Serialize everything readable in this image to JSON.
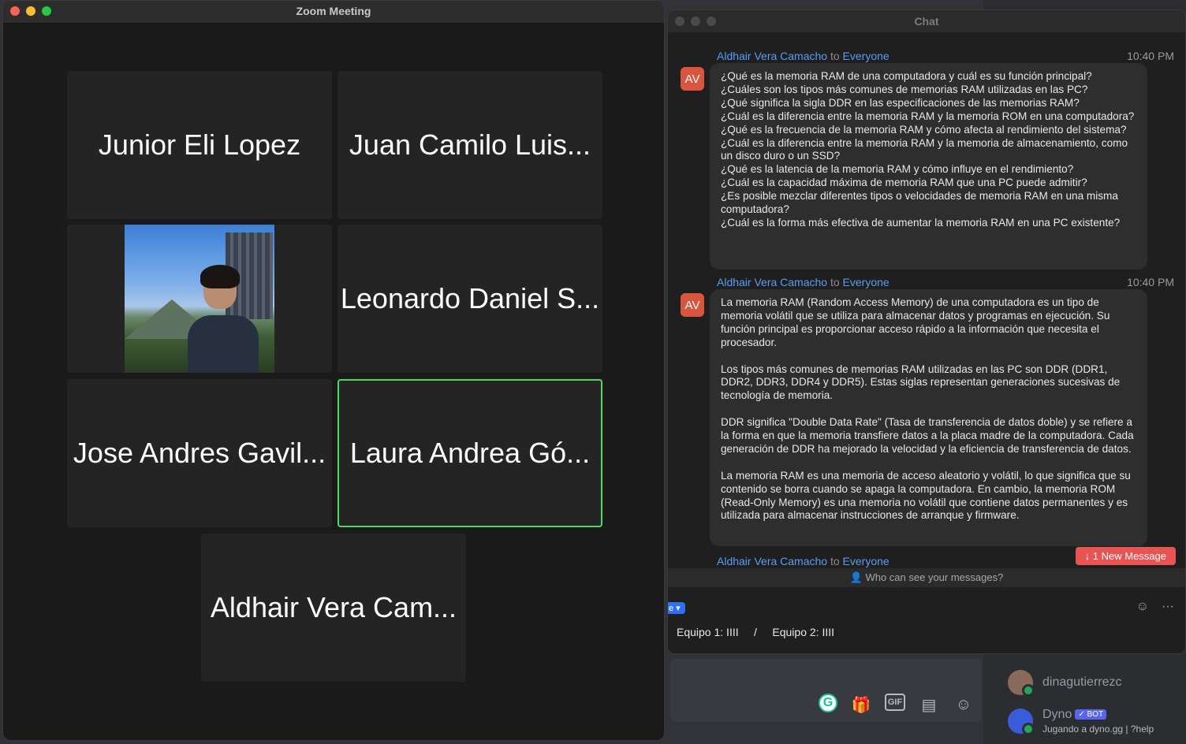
{
  "zoom": {
    "title": "Zoom Meeting",
    "participants": [
      {
        "name": "Junior Eli Lopez"
      },
      {
        "name": "Juan Camilo Luis..."
      },
      {
        "name": ""
      },
      {
        "name": "Leonardo Daniel S..."
      },
      {
        "name": "Jose Andres Gavil..."
      },
      {
        "name": "Laura Andrea Gó...",
        "active": true
      },
      {
        "name": "Aldhair Vera Cam..."
      }
    ]
  },
  "chat": {
    "title": "Chat",
    "messages": [
      {
        "sender": "Aldhair Vera Camacho",
        "to_word": "to",
        "recipient": "Everyone",
        "time": "10:40 PM",
        "avatar": "AV",
        "lines": [
          "¿Qué es la memoria RAM de una computadora y cuál es su función principal?",
          "¿Cuáles son los tipos más comunes de memorias RAM utilizadas en las PC?",
          "¿Qué significa la sigla DDR en las especificaciones de las memorias RAM?",
          "¿Cuál es la diferencia entre la memoria RAM y la memoria ROM en una computadora?",
          "¿Qué es la frecuencia de la memoria RAM y cómo afecta al rendimiento del sistema?",
          "¿Cuál es la diferencia entre la memoria RAM y la memoria de almacenamiento, como un disco duro o un SSD?",
          "¿Qué es la latencia de la memoria RAM y cómo influye en el rendimiento?",
          "¿Cuál es la capacidad máxima de memoria RAM que una PC puede admitir?",
          "¿Es posible mezclar diferentes tipos o velocidades de memoria RAM en una misma computadora?",
          "¿Cuál es la forma más efectiva de aumentar la memoria RAM en una PC existente?"
        ]
      },
      {
        "sender": "Aldhair Vera Camacho",
        "to_word": "to",
        "recipient": "Everyone",
        "time": "10:40 PM",
        "avatar": "AV",
        "paragraphs": [
          "La memoria RAM (Random Access Memory) de una computadora es un tipo de memoria volátil que se utiliza para almacenar datos y programas en ejecución. Su función principal es proporcionar acceso rápido a la información que necesita el procesador.",
          "Los tipos más comunes de memorias RAM utilizadas en las PC son DDR (DDR1, DDR2, DDR3, DDR4 y DDR5). Estas siglas representan generaciones sucesivas de tecnología de memoria.",
          "DDR significa \"Double Data Rate\" (Tasa de transferencia de datos doble) y se refiere a la forma en que la memoria transfiere datos a la placa madre de la computadora. Cada generación de DDR ha mejorado la velocidad y la eficiencia de transferencia de datos.",
          "La memoria RAM es una memoria de acceso aleatorio y volátil, lo que significa que su contenido se borra cuando se apaga la computadora. En cambio, la memoria ROM (Read-Only Memory) es una memoria no volátil que contiene datos permanentes y es utilizada para almacenar instrucciones de arranque y firmware."
        ]
      },
      {
        "sender": "Aldhair Vera Camacho",
        "to_word": "to",
        "recipient": "Everyone"
      }
    ],
    "new_message_label": "↓ 1 New Message",
    "who_can_see": "Who can see your messages?",
    "to_select_label": "e ▾",
    "compose_text": "Equipo 1: IIII     /     Equipo 2: IIII"
  },
  "discord": {
    "members": [
      {
        "name": "dinagutierrezc"
      },
      {
        "name": "Dyno",
        "tag": "✓ BOT",
        "status": "Jugando a dyno.gg | ?help"
      }
    ],
    "tool_icons": [
      "grammarly-icon",
      "gift-icon",
      "gif-icon",
      "sticker-icon",
      "emoji-icon"
    ]
  },
  "colors": {
    "accent_blue": "#5a9cf5",
    "active_border": "#4cd964",
    "avatar": "#d9553e",
    "new_message": "#e85454"
  }
}
